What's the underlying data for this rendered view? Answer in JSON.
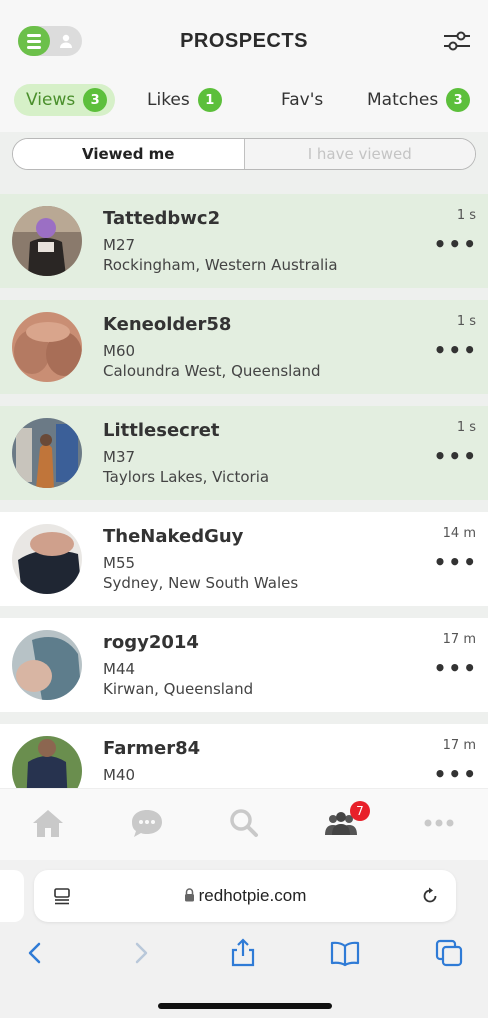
{
  "header": {
    "title": "PROSPECTS"
  },
  "tabs": [
    {
      "label": "Views",
      "count": "3"
    },
    {
      "label": "Likes",
      "count": "1"
    },
    {
      "label": "Fav's"
    },
    {
      "label": "Matches",
      "count": "3"
    }
  ],
  "segments": {
    "viewed_me": "Viewed me",
    "i_have_viewed": "I have viewed"
  },
  "profiles": [
    {
      "username": "Tattedbwc2",
      "age": "M27",
      "location": "Rockingham, Western Australia",
      "time": "1 s"
    },
    {
      "username": "Keneolder58",
      "age": "M60",
      "location": "Caloundra West, Queensland",
      "time": "1 s"
    },
    {
      "username": "Littlesecret",
      "age": "M37",
      "location": "Taylors Lakes, Victoria",
      "time": "1 s"
    },
    {
      "username": "TheNakedGuy",
      "age": "M55",
      "location": "Sydney, New South Wales",
      "time": "14 m"
    },
    {
      "username": "rogy2014",
      "age": "M44",
      "location": "Kirwan, Queensland",
      "time": "17 m"
    },
    {
      "username": "Farmer84",
      "age": "M40",
      "location": "",
      "time": "17 m"
    }
  ],
  "more_glyph": "•••",
  "bottom_nav": {
    "prospects_badge": "7"
  },
  "browser": {
    "url": "redhotpie.com"
  },
  "colors": {
    "accent_green": "#5cbf3b",
    "new_row_bg": "#e3eee0",
    "badge_red": "#e8202a"
  }
}
